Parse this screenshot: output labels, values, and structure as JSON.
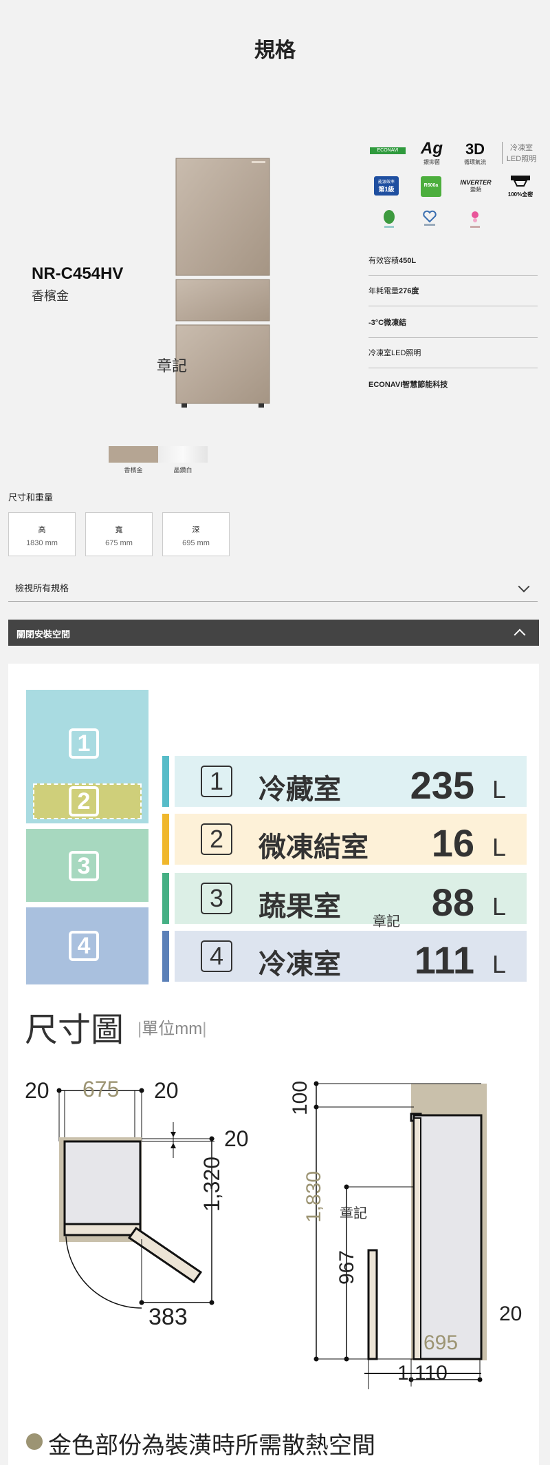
{
  "page": {
    "title": "規格"
  },
  "product": {
    "model": "NR-C454HV",
    "color_name": "香檳金",
    "stamp": "章記"
  },
  "swatches": [
    {
      "label": "香檳金",
      "color": "#b5a593"
    },
    {
      "label": "晶鑽白",
      "color": "#e6e6e6"
    }
  ],
  "badges": {
    "econavi": "ECONAVI",
    "ag_top": "Ag",
    "ag_sub": "銀抑菌",
    "three_d_top": "3D",
    "three_d_sub": "循環氣流",
    "led_top": "冷凍室",
    "led_sub": "LED照明",
    "energy_top": "能源效率",
    "energy_mid": "第1級",
    "r600": "R600a",
    "inverter_top": "INVERTER",
    "inverter_sub": "變頻",
    "full_seal": "100%全密"
  },
  "features": [
    {
      "prefix": "有效容積",
      "value": "450L"
    },
    {
      "prefix": "年耗電量",
      "value": "276度"
    },
    {
      "prefix": "",
      "value": "-3°C微凍結"
    },
    {
      "prefix": "冷凍室LED照明",
      "value": ""
    },
    {
      "prefix": "",
      "value": "ECONAVI智慧節能科技"
    }
  ],
  "dimensions": {
    "section_label": "尺寸和重量",
    "boxes": [
      {
        "label": "高",
        "value": "1830 mm"
      },
      {
        "label": "寬",
        "value": "675 mm"
      },
      {
        "label": "深",
        "value": "695 mm"
      }
    ]
  },
  "view_specs_label": "檢視所有規格",
  "install_label": "關閉安裝空間",
  "compartments": [
    {
      "num": "1",
      "name": "冷藏室",
      "capacity": "235",
      "unit": "L",
      "color": "#57bcc8",
      "bg": "#dff1f3"
    },
    {
      "num": "2",
      "name": "微凍結室",
      "capacity": "16",
      "unit": "L",
      "color": "#f0b72c",
      "bg": "#fdf1d8"
    },
    {
      "num": "3",
      "name": "蔬果室",
      "capacity": "88",
      "unit": "L",
      "color": "#45b084",
      "bg": "#dcefe6"
    },
    {
      "num": "4",
      "name": "冷凍室",
      "capacity": "111",
      "unit": "L",
      "color": "#5b80b8",
      "bg": "#dde4ef"
    }
  ],
  "zone_colors": {
    "z1": "#a9dbe1",
    "z2": "#cfcf7a",
    "z3": "#a7d8bf",
    "z4": "#a9c0de"
  },
  "dimension_drawing": {
    "title": "尺寸圖",
    "unit": "單位mm",
    "top_left": "20",
    "top_width": "675",
    "top_right": "20",
    "right_gap": "20",
    "door_depth": "1,320",
    "door_swing": "383",
    "top_clearance": "100",
    "height": "1,830",
    "lower_height": "967",
    "back_gap": "20",
    "depth": "695",
    "total_depth": "1,110"
  },
  "footnote": "金色部份為裝潢時所需散熱空間"
}
